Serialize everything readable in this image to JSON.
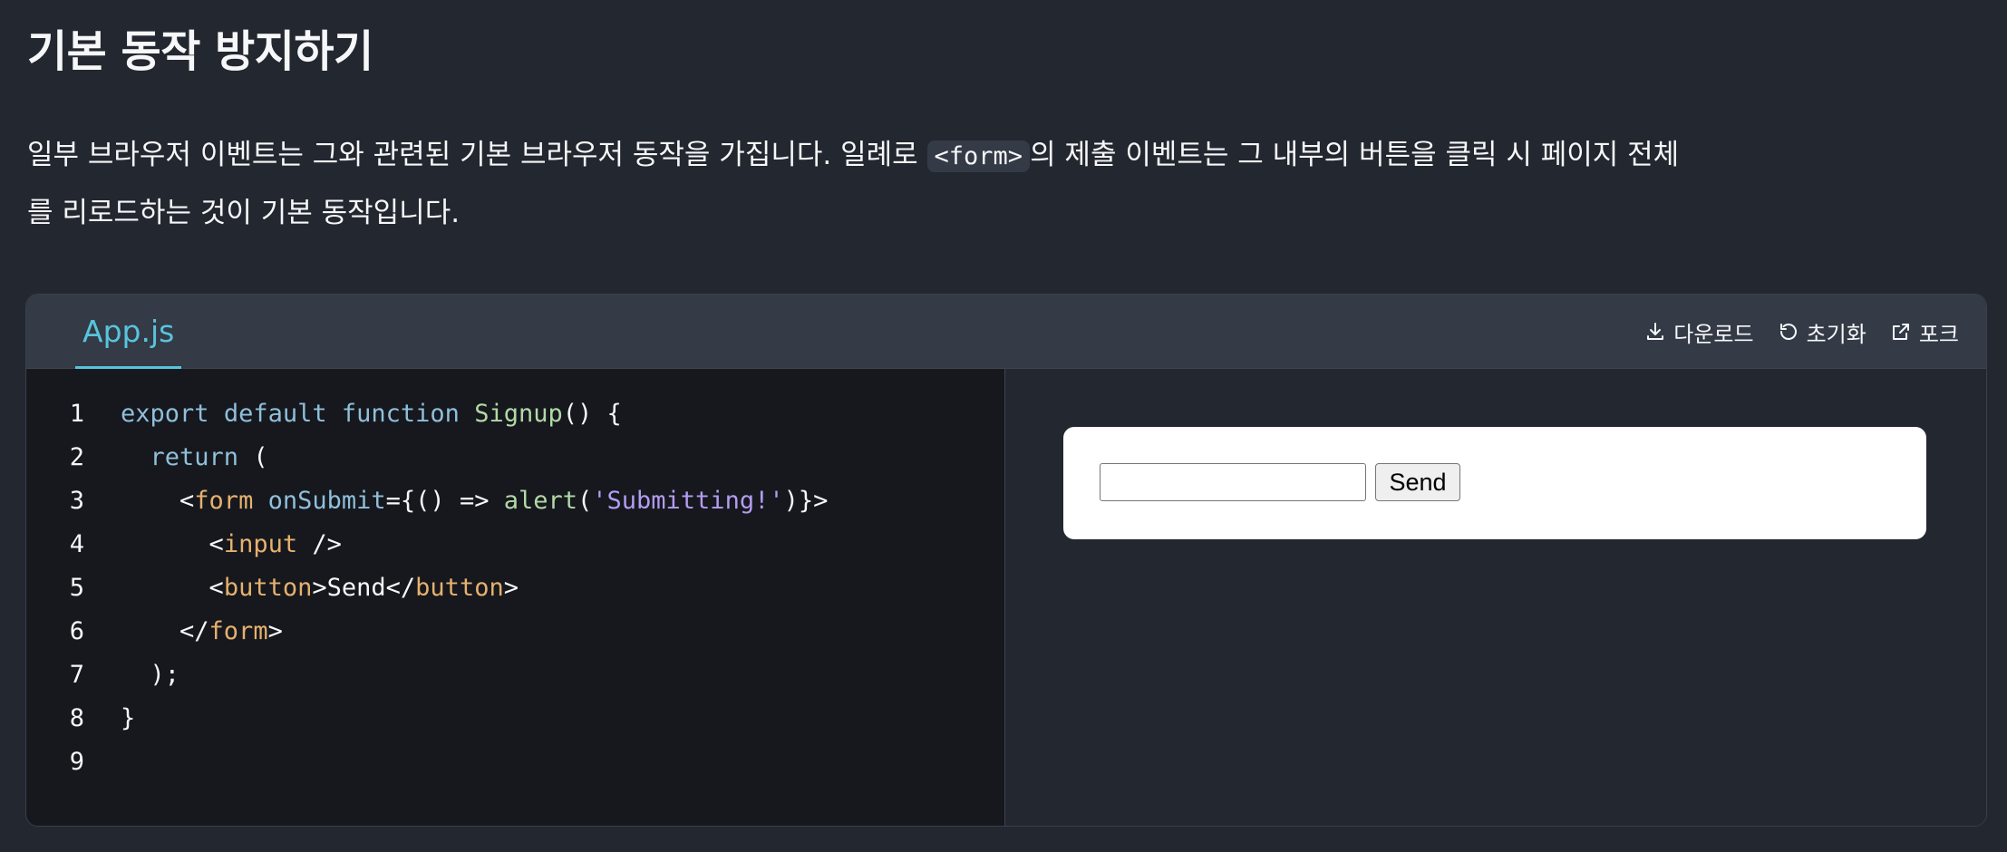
{
  "heading": "기본 동작 방지하기",
  "paragraph": {
    "before": "일부 브라우저 이벤트는 그와 관련된 기본 브라우저 동작을 가집니다. 일례로 ",
    "code": "<form>",
    "after": "의 제출 이벤트는 그 내부의 버튼을 클릭 시 페이지 전체를 리로드하는 것이 기본 동작입니다."
  },
  "sandbox": {
    "tab_label": "App.js",
    "actions": {
      "download": "다운로드",
      "reset": "초기화",
      "fork": "포크"
    },
    "code_lines": [
      "export default function Signup() {",
      "  return (",
      "    <form onSubmit={() => alert('Submitting!')}>",
      "      <input />",
      "      <button>Send</button>",
      "    </form>",
      "  );",
      "}",
      ""
    ],
    "line_numbers": [
      "1",
      "2",
      "3",
      "4",
      "5",
      "6",
      "7",
      "8",
      "9"
    ],
    "preview": {
      "button_label": "Send",
      "input_value": ""
    }
  },
  "icons": {
    "download": "download-icon",
    "reset": "reset-icon",
    "fork": "external-link-icon"
  },
  "colors": {
    "background": "#23272f",
    "accent": "#58c4dc",
    "keyword": "#90bfdb",
    "function": "#b2d9a6",
    "tag": "#e6b16e",
    "string": "#b49cf2"
  }
}
